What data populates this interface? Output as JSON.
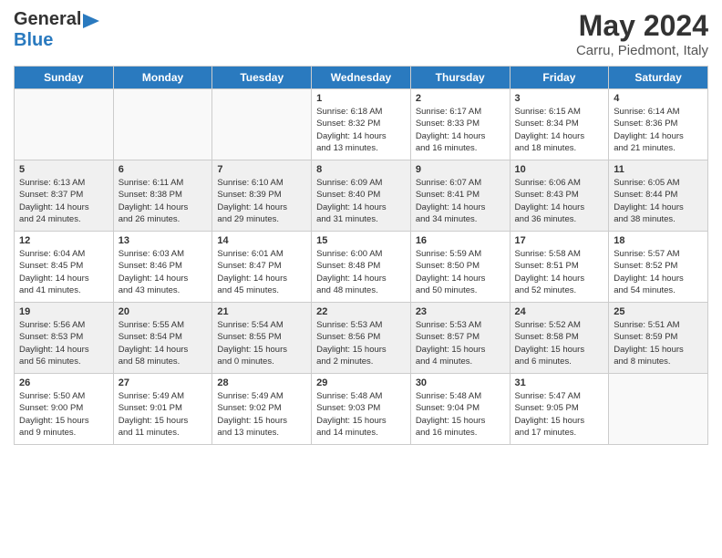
{
  "logo": {
    "line1": "General",
    "line2": "Blue"
  },
  "title": "May 2024",
  "subtitle": "Carru, Piedmont, Italy",
  "headers": [
    "Sunday",
    "Monday",
    "Tuesday",
    "Wednesday",
    "Thursday",
    "Friday",
    "Saturday"
  ],
  "rows": [
    [
      {
        "day": "",
        "info": "",
        "empty": true
      },
      {
        "day": "",
        "info": "",
        "empty": true
      },
      {
        "day": "",
        "info": "",
        "empty": true
      },
      {
        "day": "1",
        "info": "Sunrise: 6:18 AM\nSunset: 8:32 PM\nDaylight: 14 hours\nand 13 minutes.",
        "empty": false
      },
      {
        "day": "2",
        "info": "Sunrise: 6:17 AM\nSunset: 8:33 PM\nDaylight: 14 hours\nand 16 minutes.",
        "empty": false
      },
      {
        "day": "3",
        "info": "Sunrise: 6:15 AM\nSunset: 8:34 PM\nDaylight: 14 hours\nand 18 minutes.",
        "empty": false
      },
      {
        "day": "4",
        "info": "Sunrise: 6:14 AM\nSunset: 8:36 PM\nDaylight: 14 hours\nand 21 minutes.",
        "empty": false
      }
    ],
    [
      {
        "day": "5",
        "info": "Sunrise: 6:13 AM\nSunset: 8:37 PM\nDaylight: 14 hours\nand 24 minutes.",
        "empty": false
      },
      {
        "day": "6",
        "info": "Sunrise: 6:11 AM\nSunset: 8:38 PM\nDaylight: 14 hours\nand 26 minutes.",
        "empty": false
      },
      {
        "day": "7",
        "info": "Sunrise: 6:10 AM\nSunset: 8:39 PM\nDaylight: 14 hours\nand 29 minutes.",
        "empty": false
      },
      {
        "day": "8",
        "info": "Sunrise: 6:09 AM\nSunset: 8:40 PM\nDaylight: 14 hours\nand 31 minutes.",
        "empty": false
      },
      {
        "day": "9",
        "info": "Sunrise: 6:07 AM\nSunset: 8:41 PM\nDaylight: 14 hours\nand 34 minutes.",
        "empty": false
      },
      {
        "day": "10",
        "info": "Sunrise: 6:06 AM\nSunset: 8:43 PM\nDaylight: 14 hours\nand 36 minutes.",
        "empty": false
      },
      {
        "day": "11",
        "info": "Sunrise: 6:05 AM\nSunset: 8:44 PM\nDaylight: 14 hours\nand 38 minutes.",
        "empty": false
      }
    ],
    [
      {
        "day": "12",
        "info": "Sunrise: 6:04 AM\nSunset: 8:45 PM\nDaylight: 14 hours\nand 41 minutes.",
        "empty": false
      },
      {
        "day": "13",
        "info": "Sunrise: 6:03 AM\nSunset: 8:46 PM\nDaylight: 14 hours\nand 43 minutes.",
        "empty": false
      },
      {
        "day": "14",
        "info": "Sunrise: 6:01 AM\nSunset: 8:47 PM\nDaylight: 14 hours\nand 45 minutes.",
        "empty": false
      },
      {
        "day": "15",
        "info": "Sunrise: 6:00 AM\nSunset: 8:48 PM\nDaylight: 14 hours\nand 48 minutes.",
        "empty": false
      },
      {
        "day": "16",
        "info": "Sunrise: 5:59 AM\nSunset: 8:50 PM\nDaylight: 14 hours\nand 50 minutes.",
        "empty": false
      },
      {
        "day": "17",
        "info": "Sunrise: 5:58 AM\nSunset: 8:51 PM\nDaylight: 14 hours\nand 52 minutes.",
        "empty": false
      },
      {
        "day": "18",
        "info": "Sunrise: 5:57 AM\nSunset: 8:52 PM\nDaylight: 14 hours\nand 54 minutes.",
        "empty": false
      }
    ],
    [
      {
        "day": "19",
        "info": "Sunrise: 5:56 AM\nSunset: 8:53 PM\nDaylight: 14 hours\nand 56 minutes.",
        "empty": false
      },
      {
        "day": "20",
        "info": "Sunrise: 5:55 AM\nSunset: 8:54 PM\nDaylight: 14 hours\nand 58 minutes.",
        "empty": false
      },
      {
        "day": "21",
        "info": "Sunrise: 5:54 AM\nSunset: 8:55 PM\nDaylight: 15 hours\nand 0 minutes.",
        "empty": false
      },
      {
        "day": "22",
        "info": "Sunrise: 5:53 AM\nSunset: 8:56 PM\nDaylight: 15 hours\nand 2 minutes.",
        "empty": false
      },
      {
        "day": "23",
        "info": "Sunrise: 5:53 AM\nSunset: 8:57 PM\nDaylight: 15 hours\nand 4 minutes.",
        "empty": false
      },
      {
        "day": "24",
        "info": "Sunrise: 5:52 AM\nSunset: 8:58 PM\nDaylight: 15 hours\nand 6 minutes.",
        "empty": false
      },
      {
        "day": "25",
        "info": "Sunrise: 5:51 AM\nSunset: 8:59 PM\nDaylight: 15 hours\nand 8 minutes.",
        "empty": false
      }
    ],
    [
      {
        "day": "26",
        "info": "Sunrise: 5:50 AM\nSunset: 9:00 PM\nDaylight: 15 hours\nand 9 minutes.",
        "empty": false
      },
      {
        "day": "27",
        "info": "Sunrise: 5:49 AM\nSunset: 9:01 PM\nDaylight: 15 hours\nand 11 minutes.",
        "empty": false
      },
      {
        "day": "28",
        "info": "Sunrise: 5:49 AM\nSunset: 9:02 PM\nDaylight: 15 hours\nand 13 minutes.",
        "empty": false
      },
      {
        "day": "29",
        "info": "Sunrise: 5:48 AM\nSunset: 9:03 PM\nDaylight: 15 hours\nand 14 minutes.",
        "empty": false
      },
      {
        "day": "30",
        "info": "Sunrise: 5:48 AM\nSunset: 9:04 PM\nDaylight: 15 hours\nand 16 minutes.",
        "empty": false
      },
      {
        "day": "31",
        "info": "Sunrise: 5:47 AM\nSunset: 9:05 PM\nDaylight: 15 hours\nand 17 minutes.",
        "empty": false
      },
      {
        "day": "",
        "info": "",
        "empty": true
      }
    ]
  ]
}
